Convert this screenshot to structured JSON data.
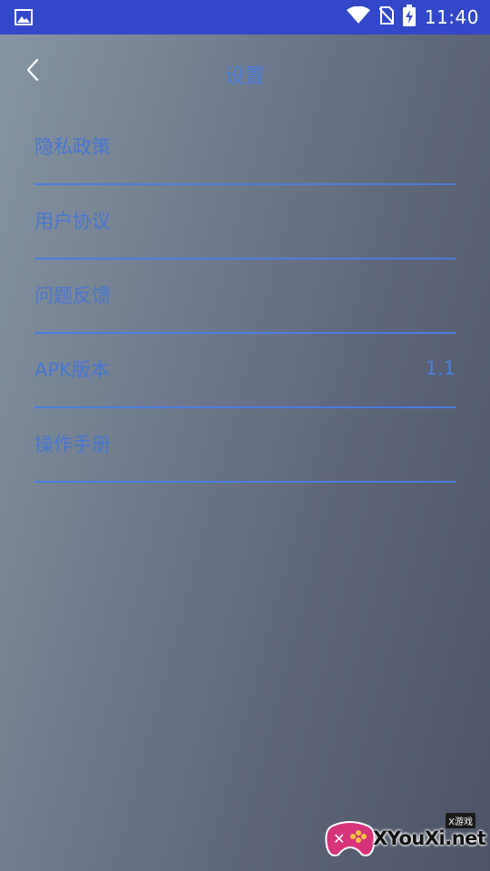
{
  "status_bar": {
    "time": "11:40",
    "left_icon": "image-icon",
    "right_icons": [
      "wifi-icon",
      "no-sim-icon",
      "battery-charging-icon"
    ]
  },
  "header": {
    "title": "设置",
    "back_icon": "chevron-left-icon"
  },
  "settings": {
    "items": [
      {
        "label": "隐私政策",
        "value": ""
      },
      {
        "label": "用户协议",
        "value": ""
      },
      {
        "label": "问题反馈",
        "value": ""
      },
      {
        "label": "APK版本",
        "value": "1.1"
      },
      {
        "label": "操作手册",
        "value": ""
      }
    ]
  },
  "watermark": {
    "badge": "X游戏",
    "text": "XYouXi.net"
  },
  "colors": {
    "status_bar": "#3248c9",
    "accent": "#4a7ee0",
    "text_blue": "#4876cf"
  }
}
